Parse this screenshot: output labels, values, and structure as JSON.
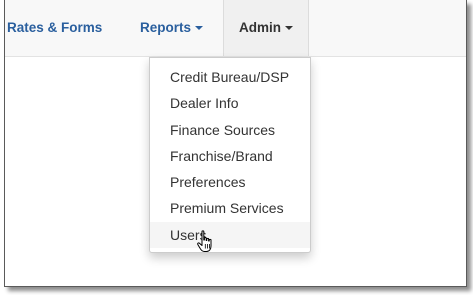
{
  "navbar": {
    "items": [
      {
        "label": "Rates & Forms",
        "has_caret": false
      },
      {
        "label": "Reports",
        "has_caret": true
      },
      {
        "label": "Admin",
        "has_caret": true,
        "open": true
      }
    ]
  },
  "admin_menu": {
    "items": [
      {
        "label": "Credit Bureau/DSP"
      },
      {
        "label": "Dealer Info"
      },
      {
        "label": "Finance Sources"
      },
      {
        "label": "Franchise/Brand"
      },
      {
        "label": "Preferences"
      },
      {
        "label": "Premium Services"
      },
      {
        "label": "Users",
        "hovered": true
      }
    ]
  },
  "cursor": {
    "icon": "hand-pointer-icon"
  },
  "colors": {
    "nav_link": "#2a5f9e",
    "nav_active_text": "#333333",
    "navbar_bg": "#f8f8f8",
    "menu_hover_bg": "#f5f5f5"
  }
}
